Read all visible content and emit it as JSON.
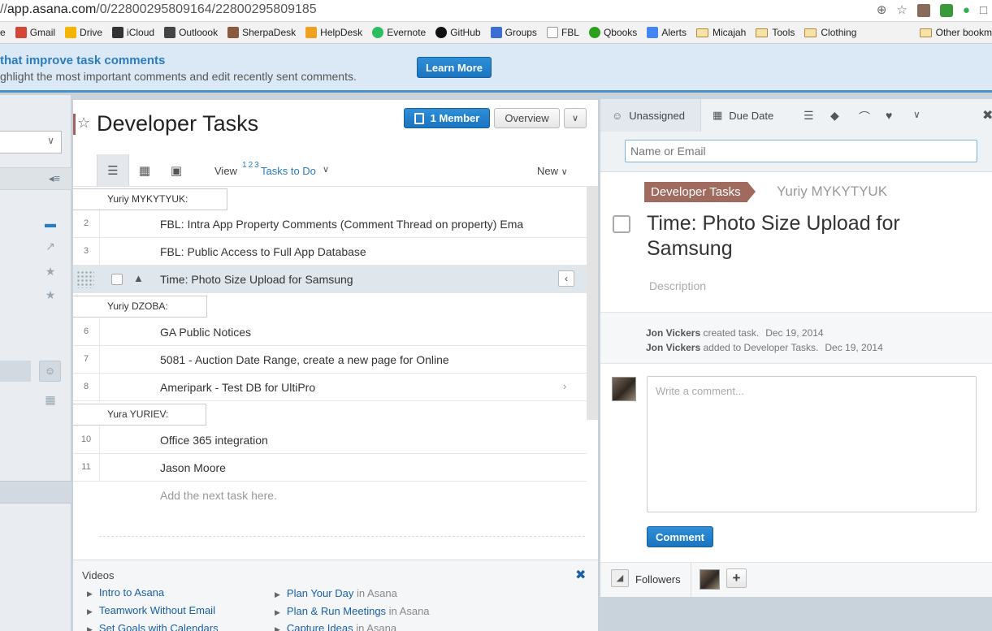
{
  "browser": {
    "url_prefix": "//",
    "url_host": "app.asana.com",
    "url_path": "/0/22800295809164/22800295809185",
    "bookmarks": [
      {
        "label": "e",
        "icon": "none"
      },
      {
        "label": "Gmail",
        "icon": "gmail-icon"
      },
      {
        "label": "Drive",
        "icon": "drive-icon"
      },
      {
        "label": "iCloud",
        "icon": "apple-icon"
      },
      {
        "label": "Outloook",
        "icon": "outlook-icon"
      },
      {
        "label": "SherpaDesk",
        "icon": "sherpadesk-icon"
      },
      {
        "label": "HelpDesk",
        "icon": "helpdesk-icon"
      },
      {
        "label": "Evernote",
        "icon": "evernote-icon"
      },
      {
        "label": "GitHub",
        "icon": "github-icon"
      },
      {
        "label": "Groups",
        "icon": "groups-icon"
      },
      {
        "label": "FBL",
        "icon": "page-icon"
      },
      {
        "label": "Qbooks",
        "icon": "qbooks-icon"
      },
      {
        "label": "Alerts",
        "icon": "alerts-icon"
      },
      {
        "label": "Micajah",
        "icon": "folder-icon"
      },
      {
        "label": "Tools",
        "icon": "folder-icon"
      },
      {
        "label": "Clothing",
        "icon": "folder-icon"
      }
    ],
    "other_bookmarks": "Other bookm"
  },
  "banner": {
    "title": "that improve task comments",
    "subtitle": "ghlight the most important comments and edit recently sent comments.",
    "learn_more": "Learn More"
  },
  "project": {
    "title": "Developer Tasks",
    "member_button": "1 Member",
    "overview_button": "Overview",
    "view_label": "View",
    "view_sup": "1 2 3",
    "view_value": "Tasks to Do",
    "new_label": "New"
  },
  "sections": [
    {
      "label": "Yuriy MYKYTYUK:"
    },
    {
      "label": "Yuriy DZOBA:"
    },
    {
      "label": "Yura YURIEV:"
    }
  ],
  "tasks": [
    {
      "num": "2",
      "label": "FBL: Intra App Property Comments (Comment Thread on property) Ema"
    },
    {
      "num": "3",
      "label": "FBL: Public Access to Full App Database"
    },
    {
      "num": "",
      "label": "Time: Photo Size Upload for Samsung"
    },
    {
      "num": "6",
      "label": "GA Public Notices"
    },
    {
      "num": "7",
      "label": "5081 - Auction Date Range, create a new page for Online"
    },
    {
      "num": "8",
      "label": "Ameripark - Test DB for UltiPro"
    },
    {
      "num": "10",
      "label": "Office 365 integration"
    },
    {
      "num": "11",
      "label": "Jason Moore"
    }
  ],
  "add_next": "Add the next task here.",
  "videos": {
    "title": "Videos",
    "items": [
      {
        "label": "Intro to Asana",
        "muted": ""
      },
      {
        "label": "Teamwork Without Email",
        "muted": ""
      },
      {
        "label": "Set Goals with Calendars",
        "muted": ""
      },
      {
        "label": "Plan Your Day",
        "muted": " in Asana"
      },
      {
        "label": "Plan & Run Meetings",
        "muted": " in Asana"
      },
      {
        "label": "Capture Ideas",
        "muted": " in Asana"
      }
    ]
  },
  "detail": {
    "assignee_tab": "Unassigned",
    "due_date_tab": "Due Date",
    "assignee_placeholder": "Name or Email",
    "project_tag": "Developer Tasks",
    "section_tag": "Yuriy MYKYTYUK",
    "task_name": "Time: Photo Size Upload for Samsung",
    "description_placeholder": "Description",
    "activity": [
      {
        "actor": "Jon Vickers",
        "action": " created task.",
        "date": "Dec 19, 2014"
      },
      {
        "actor": "Jon Vickers",
        "action": " added to Developer Tasks.",
        "date": "Dec 19, 2014"
      }
    ],
    "comment_placeholder": "Write a comment...",
    "comment_button": "Comment",
    "followers_label": "Followers"
  },
  "colors": {
    "accent_blue": "#1b74bf",
    "project_tag": "#a06a5f"
  }
}
